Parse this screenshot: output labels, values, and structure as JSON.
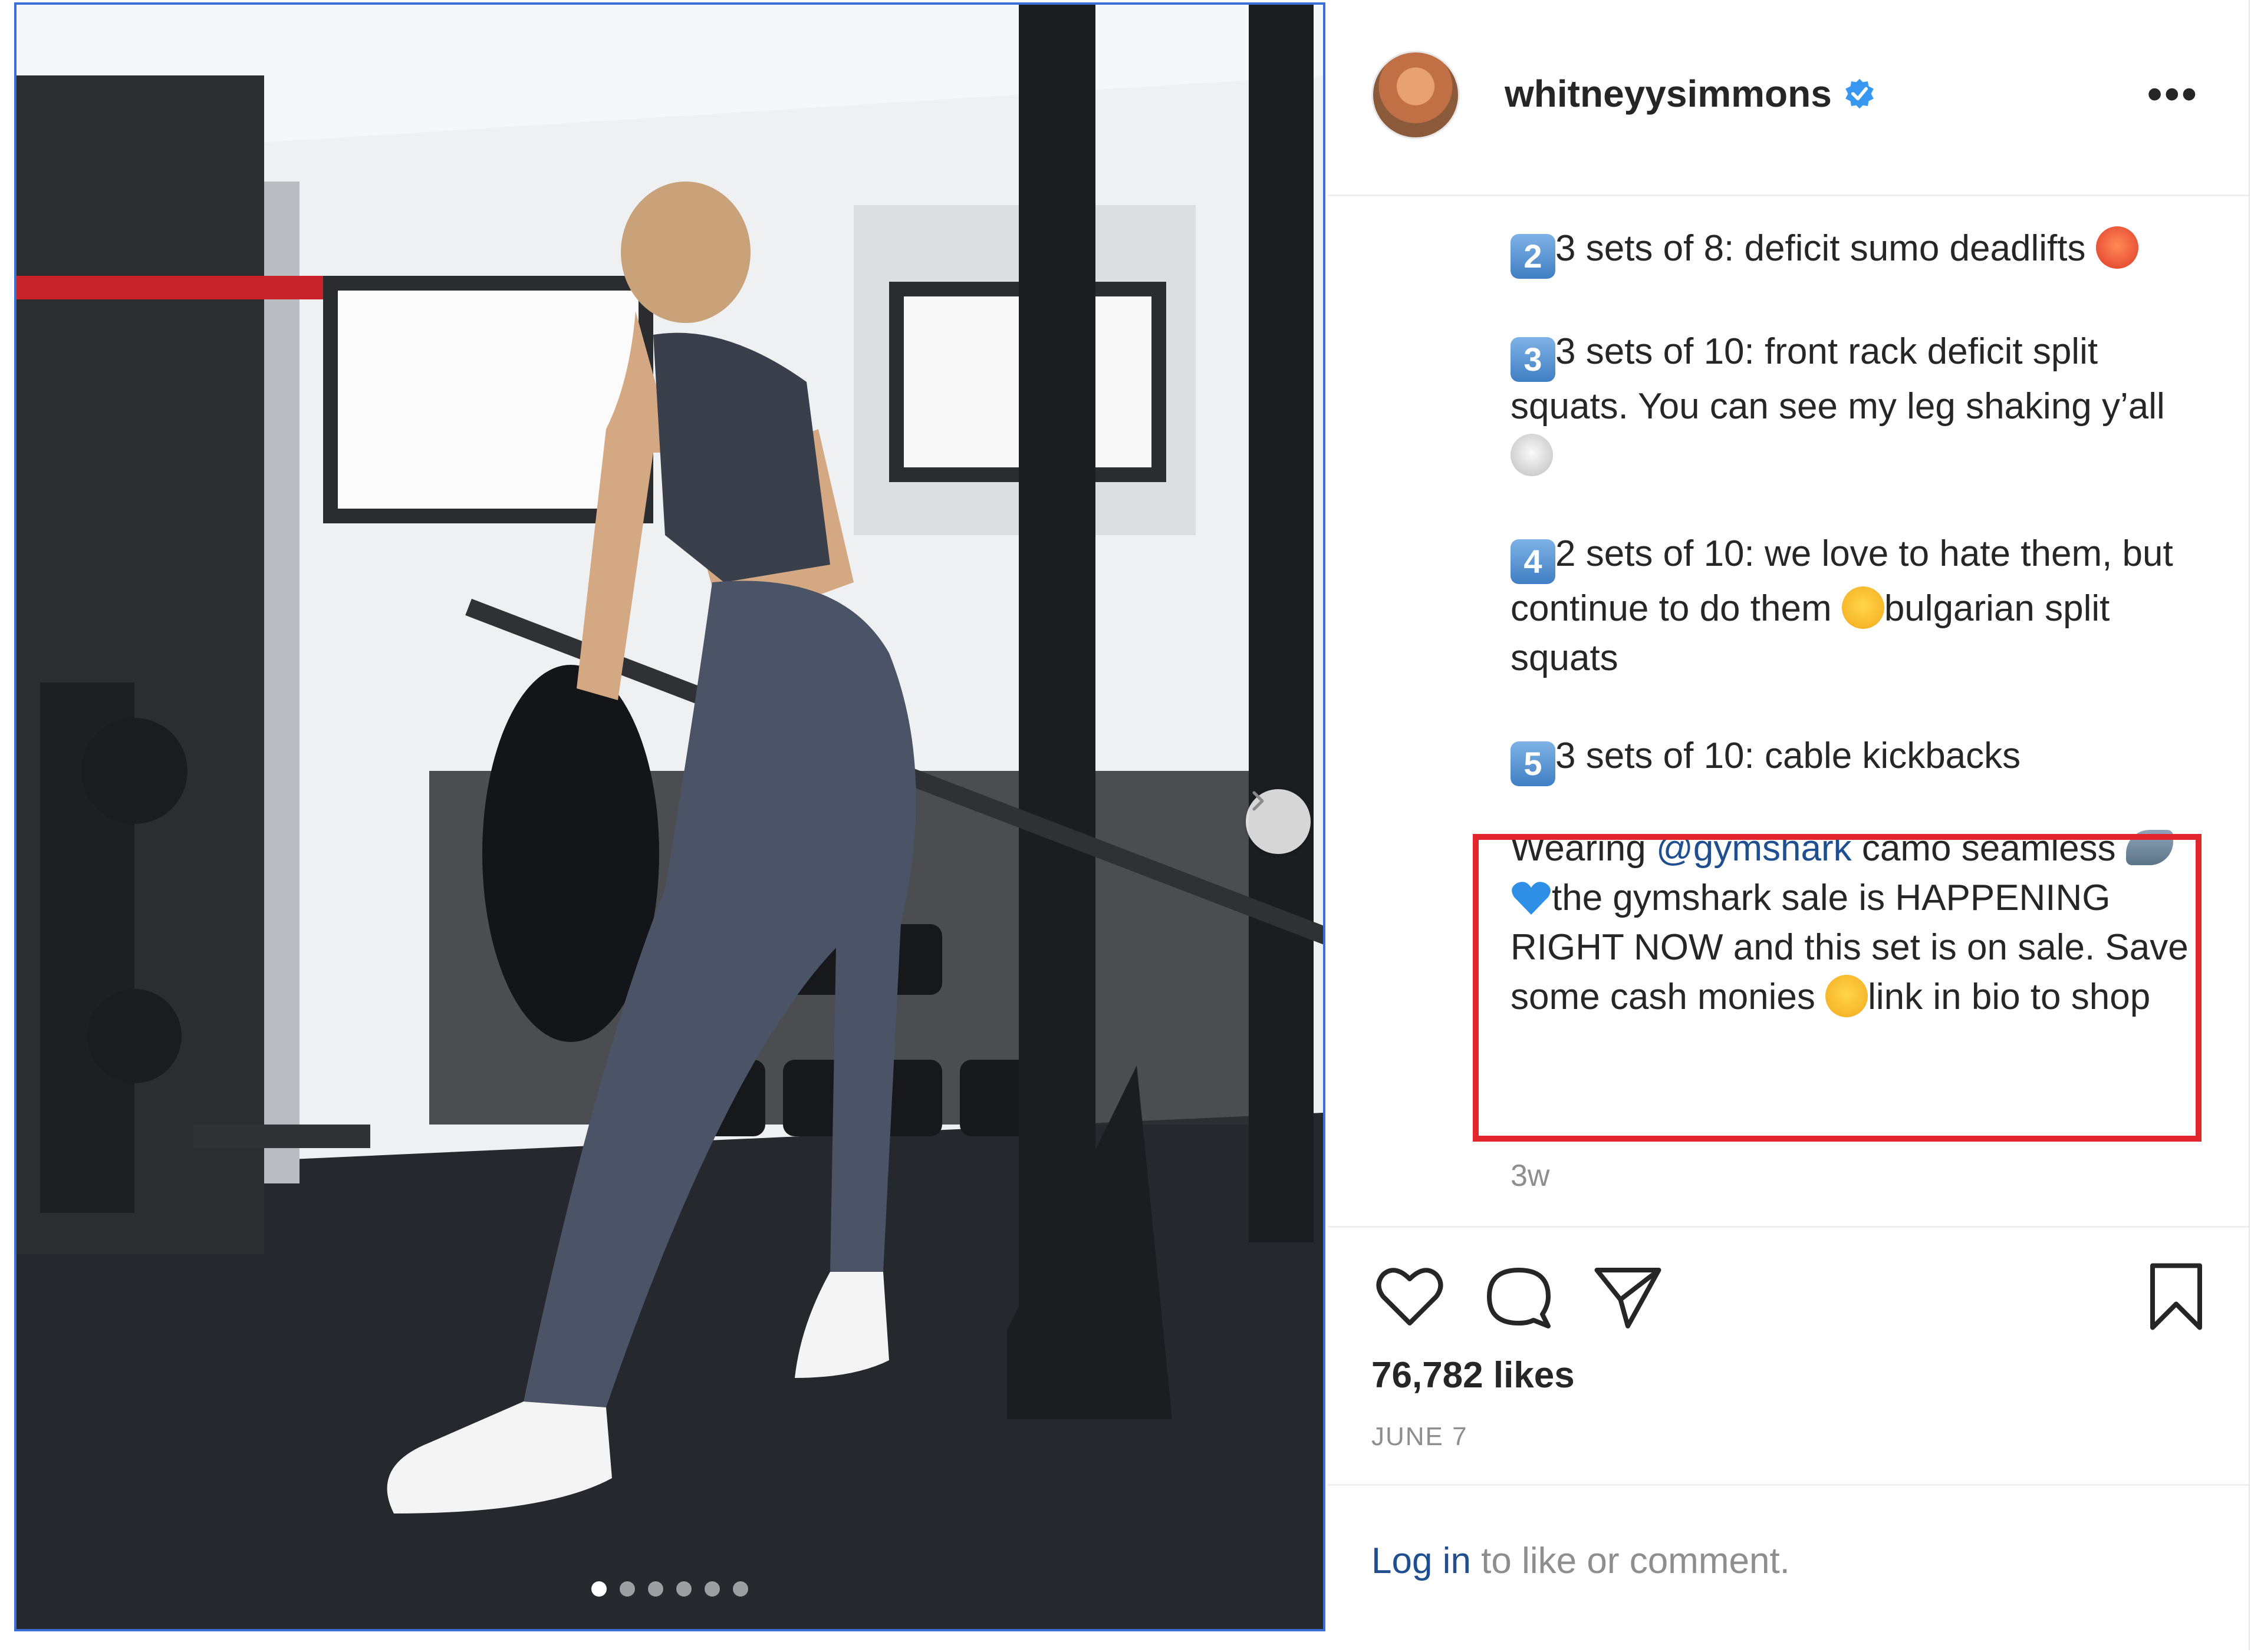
{
  "post": {
    "username": "whitneyysimmons",
    "more_label": "•••",
    "carousel_dots": 6,
    "active_dot": 0
  },
  "caption": {
    "p2_key": "2",
    "p2_text": "3 sets of 8: deficit sumo deadlifts",
    "p3_key": "3",
    "p3_text": "3 sets of 10: front rack deficit split squats. You can see my leg shaking y’all",
    "p4_key": "4",
    "p4_text_a": "2 sets of 10: we love to hate them, but continue to do them",
    "p4_text_b": "bulgarian split squats",
    "p5_key": "5",
    "p5_text": "3 sets of 10: cable kickbacks",
    "sponsor_a": "Wearing ",
    "sponsor_mention": "@gymshark",
    "sponsor_b": " camo seamless ",
    "sponsor_c": "the gymshark sale is HAPPENING RIGHT NOW and this set is on sale. Save some cash monies ",
    "sponsor_d": "link in bio to shop",
    "time_ago": "3w"
  },
  "actions": {
    "likes": "76,782 likes",
    "date": "JUNE 7",
    "login_link": "Log in",
    "login_rest": " to like or comment."
  },
  "colors": {
    "highlight": "#e3262e",
    "verified": "#3897f0",
    "link": "#1f4f8f"
  }
}
